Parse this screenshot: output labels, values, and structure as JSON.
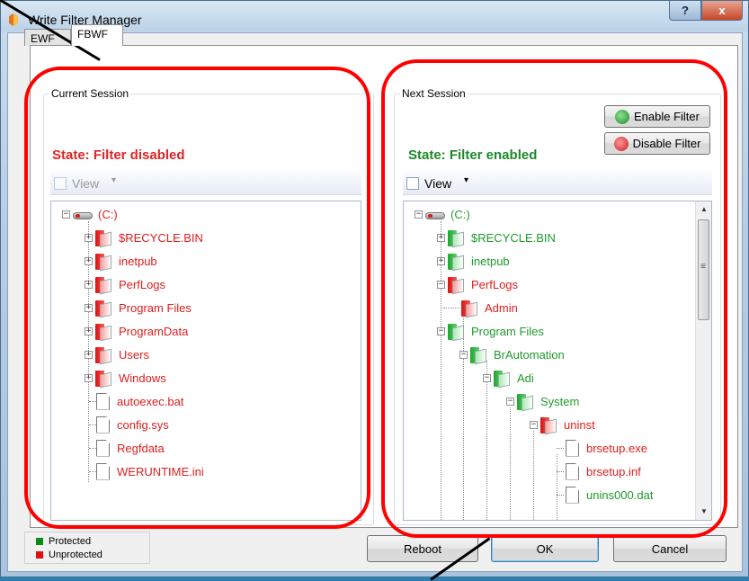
{
  "window": {
    "title": "Write Filter Manager",
    "help_label": "?",
    "close_label": "x"
  },
  "tabs": [
    {
      "label": "EWF"
    },
    {
      "label": "FBWF"
    }
  ],
  "current": {
    "group_label": "Current Session",
    "state_text": "State: Filter disabled",
    "view_label": "View",
    "view_arrow": "▾",
    "root_label": "(C:)",
    "items": [
      {
        "label": "$RECYCLE.BIN",
        "kind": "folder"
      },
      {
        "label": "inetpub",
        "kind": "folder"
      },
      {
        "label": "PerfLogs",
        "kind": "folder"
      },
      {
        "label": "Program Files",
        "kind": "folder"
      },
      {
        "label": "ProgramData",
        "kind": "folder"
      },
      {
        "label": "Users",
        "kind": "folder"
      },
      {
        "label": "Windows",
        "kind": "folder"
      },
      {
        "label": "autoexec.bat",
        "kind": "file"
      },
      {
        "label": "config.sys",
        "kind": "file"
      },
      {
        "label": "Regfdata",
        "kind": "file"
      },
      {
        "label": "WERUNTIME.ini",
        "kind": "file"
      }
    ]
  },
  "next": {
    "group_label": "Next Session",
    "state_text": "State: Filter enabled",
    "enable_label": "Enable Filter",
    "disable_label": "Disable Filter",
    "view_label": "View",
    "view_arrow": "▾",
    "root_label": "(C:)",
    "items": [
      {
        "label": "$RECYCLE.BIN",
        "status": "protected"
      },
      {
        "label": "inetpub",
        "status": "protected"
      },
      {
        "label": "PerfLogs",
        "status": "unprotected"
      },
      {
        "label": "Admin",
        "status": "unprotected"
      },
      {
        "label": "Program Files",
        "status": "protected"
      },
      {
        "label": "BrAutomation",
        "status": "protected"
      },
      {
        "label": "Adi",
        "status": "protected"
      },
      {
        "label": "System",
        "status": "protected"
      },
      {
        "label": "uninst",
        "status": "unprotected"
      },
      {
        "label": "brsetup.exe",
        "status": "unprotected"
      },
      {
        "label": "brsetup.inf",
        "status": "unprotected"
      },
      {
        "label": "unins000.dat",
        "status": "protected"
      }
    ],
    "scroll_up": "▲",
    "scroll_down": "▼",
    "scroll_grip": "≡"
  },
  "legend": {
    "protected_label": "Protected",
    "unprotected_label": "Unprotected",
    "protected_color": "#0b8a1a",
    "unprotected_color": "#e01010"
  },
  "buttons": {
    "reboot_label": "Reboot",
    "ok_label": "OK",
    "cancel_label": "Cancel"
  },
  "colors": {
    "annotation_red": "#ff0000",
    "state_red": "#e32222",
    "state_green": "#1c8a2a"
  }
}
